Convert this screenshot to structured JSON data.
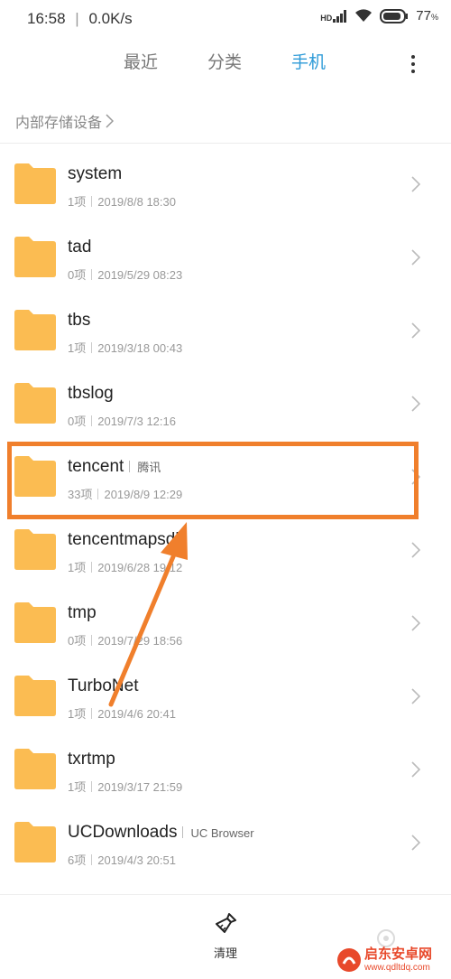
{
  "status_bar": {
    "time": "16:58",
    "speed": "0.0K/s",
    "network_badge": "HD",
    "battery": "77",
    "battery_unit": "%"
  },
  "tabs": [
    {
      "label": "最近",
      "active": false
    },
    {
      "label": "分类",
      "active": false
    },
    {
      "label": "手机",
      "active": true
    }
  ],
  "breadcrumb": {
    "label": "内部存储设备"
  },
  "files": [
    {
      "name": "system",
      "tag": "",
      "count": "1项",
      "date": "2019/8/8 18:30"
    },
    {
      "name": "tad",
      "tag": "",
      "count": "0项",
      "date": "2019/5/29 08:23"
    },
    {
      "name": "tbs",
      "tag": "",
      "count": "1项",
      "date": "2019/3/18 00:43"
    },
    {
      "name": "tbslog",
      "tag": "",
      "count": "0项",
      "date": "2019/7/3 12:16"
    },
    {
      "name": "tencent",
      "tag": "腾讯",
      "count": "33项",
      "date": "2019/8/9 12:29"
    },
    {
      "name": "tencentmapsdk",
      "tag": "",
      "count": "1项",
      "date": "2019/6/28 19:12"
    },
    {
      "name": "tmp",
      "tag": "",
      "count": "0项",
      "date": "2019/7/29 18:56"
    },
    {
      "name": "TurboNet",
      "tag": "",
      "count": "1项",
      "date": "2019/4/6 20:41"
    },
    {
      "name": "txrtmp",
      "tag": "",
      "count": "1项",
      "date": "2019/3/17 21:59"
    },
    {
      "name": "UCDownloads",
      "tag": "UC Browser",
      "count": "6项",
      "date": "2019/4/3 20:51"
    }
  ],
  "bottom_bar": {
    "clean_label": "清理"
  },
  "watermark": {
    "text": "启东安卓网",
    "url": "www.qdltdq.com"
  },
  "colors": {
    "accent": "#2e9bd8",
    "folder": "#fbbc52",
    "highlight": "#f07f2c"
  },
  "icons": {
    "folder": "folder-icon",
    "chevron": "chevron-right-icon",
    "more": "more-vertical-icon",
    "clean": "broom-icon"
  }
}
